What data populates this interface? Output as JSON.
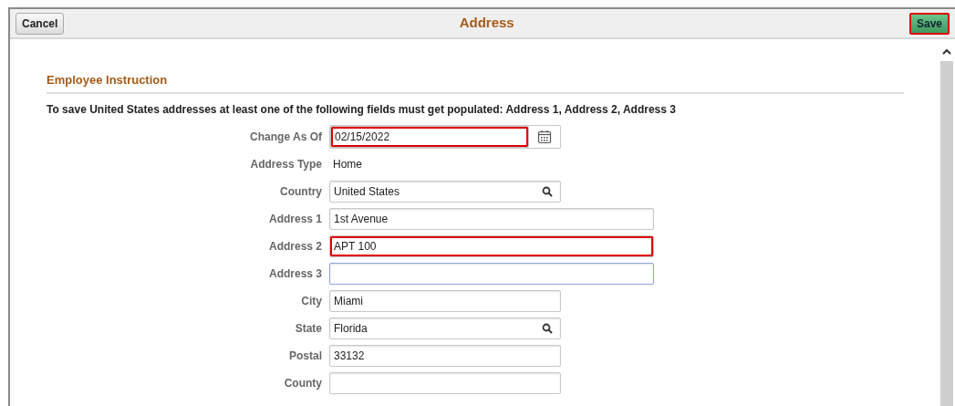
{
  "header": {
    "cancel": {
      "label": "Cancel"
    },
    "title": "Address",
    "save": {
      "label": "Save",
      "highlighted": true
    }
  },
  "section": {
    "heading": "Employee Instruction",
    "instruction": "To save United States addresses at least one of the following fields must get populated: Address 1, Address 2, Address 3"
  },
  "fields": [
    {
      "label": "Change As Of",
      "kind": "date",
      "value": "02/15/2022",
      "highlighted": true,
      "focused": false
    },
    {
      "label": "Address Type",
      "kind": "display",
      "value": "Home"
    },
    {
      "label": "Country",
      "kind": "lookup",
      "value": "United States",
      "highlighted": false,
      "focused": false
    },
    {
      "label": "Address 1",
      "kind": "long_text",
      "value": "1st Avenue",
      "highlighted": false,
      "focused": false
    },
    {
      "label": "Address 2",
      "kind": "long_text",
      "value": "APT 100",
      "highlighted": true,
      "focused": false
    },
    {
      "label": "Address 3",
      "kind": "long_text",
      "highlighted": false,
      "focused": true
    },
    {
      "label": "City",
      "kind": "text",
      "value": "Miami",
      "highlighted": false,
      "focused": false
    },
    {
      "label": "State",
      "kind": "lookup",
      "value": "Florida",
      "highlighted": false,
      "focused": false
    },
    {
      "label": "Postal",
      "kind": "text",
      "value": "33132",
      "highlighted": false,
      "focused": false
    },
    {
      "label": "County",
      "kind": "text",
      "highlighted": false,
      "focused": false
    }
  ]
}
